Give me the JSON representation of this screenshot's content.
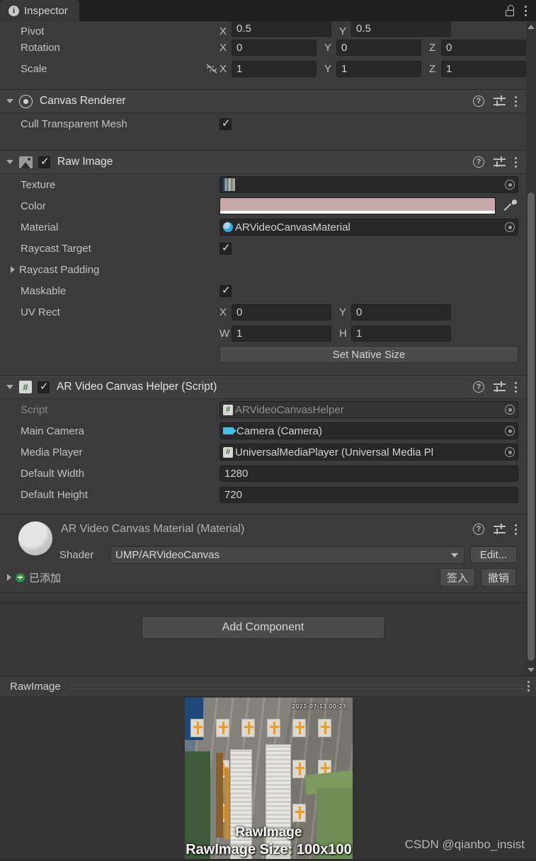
{
  "window": {
    "tab_label": "Inspector",
    "info_icon": "info-icon",
    "lock_icon": "lock-open-icon",
    "menu_icon": "kebab-menu-icon"
  },
  "transform": {
    "rows": [
      {
        "label": "Pivot",
        "axes": [
          {
            "axis": "X",
            "value": "0.5"
          },
          {
            "axis": "Y",
            "value": "0.5"
          }
        ]
      },
      {
        "label": "Rotation",
        "axes": [
          {
            "axis": "X",
            "value": "0"
          },
          {
            "axis": "Y",
            "value": "0"
          },
          {
            "axis": "Z",
            "value": "0"
          }
        ]
      },
      {
        "label": "Scale",
        "axes": [
          {
            "axis": "X",
            "value": "1"
          },
          {
            "axis": "Y",
            "value": "1"
          },
          {
            "axis": "Z",
            "value": "1"
          }
        ]
      }
    ],
    "scale_link_icon": "link-off-icon"
  },
  "canvas_renderer": {
    "title": "Canvas Renderer",
    "icon": "canvas-renderer-eye-icon",
    "cull_label": "Cull Transparent Mesh",
    "cull_checked": true
  },
  "raw_image": {
    "title": "Raw Image",
    "icon": "raw-image-icon",
    "enabled": true,
    "texture_label": "Texture",
    "color_label": "Color",
    "color_value": "#c5a6a9",
    "color_alpha": "#ffffff",
    "material_label": "Material",
    "material_value": "ARVideoCanvasMaterial",
    "raycast_target_label": "Raycast Target",
    "raycast_target_checked": true,
    "raycast_padding_label": "Raycast Padding",
    "maskable_label": "Maskable",
    "maskable_checked": true,
    "uv_rect_label": "UV Rect",
    "uv_x_axis": "X",
    "uv_x": "0",
    "uv_y_axis": "Y",
    "uv_y": "0",
    "uv_w_axis": "W",
    "uv_w": "1",
    "uv_h_axis": "H",
    "uv_h": "1",
    "set_native_size": "Set Native Size"
  },
  "helper_script": {
    "title": "AR Video Canvas Helper (Script)",
    "enabled": true,
    "script_label": "Script",
    "script_value": "ARVideoCanvasHelper",
    "main_camera_label": "Main Camera",
    "main_camera_value": "Camera (Camera)",
    "media_player_label": "Media Player",
    "media_player_value": "UniversalMediaPlayer (Universal Media Pl",
    "default_width_label": "Default Width",
    "default_width_value": "1280",
    "default_height_label": "Default Height",
    "default_height_value": "720"
  },
  "material_block": {
    "title": "AR Video Canvas Material (Material)",
    "shader_label": "Shader",
    "shader_value": "UMP/ARVideoCanvas",
    "edit_label": "Edit...",
    "vcs_status": "已添加",
    "checkin_label": "签入",
    "revert_label": "撤销"
  },
  "add_component_label": "Add Component",
  "preview": {
    "name": "RawImage",
    "timestamp": "2021-07-13 00:23:",
    "caption_line1": "RawImage",
    "caption_line2": "RawImage Size: 100x100"
  },
  "watermark": "CSDN @qianbo_insist"
}
